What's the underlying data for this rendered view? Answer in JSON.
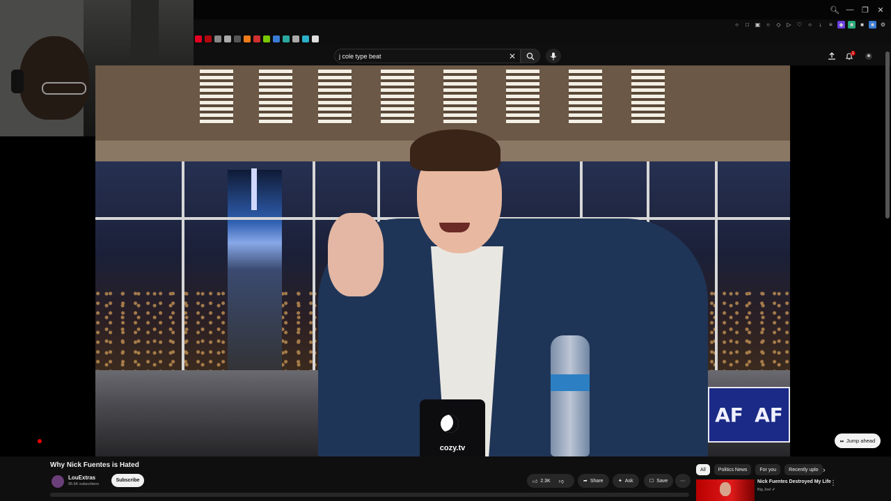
{
  "header": {
    "search_query": "j cole type beat",
    "notification_count": "1"
  },
  "video": {
    "mug_text": "cozy.tv",
    "sign_left": "AF",
    "sign_right": "AF",
    "jump_label": "Jump ahead"
  },
  "info": {
    "title": "Why Nick Fuentes is Hated",
    "channel": "LouExtras",
    "subscribers": "95.6K subscribers",
    "subscribe_label": "Subscribe",
    "likes": "2.3K",
    "share_label": "Share",
    "ask_label": "Ask",
    "save_label": "Save"
  },
  "sidebar": {
    "chips": [
      "All",
      "Politics News",
      "For you",
      "Recently uplo"
    ],
    "recommended": {
      "title": "Nick Fuentes Destroyed My Life",
      "channel": "Big Joel"
    }
  },
  "colors": {
    "background": "#0f0f0f",
    "accent_red": "#cc0000",
    "chip_bg": "#272727"
  }
}
